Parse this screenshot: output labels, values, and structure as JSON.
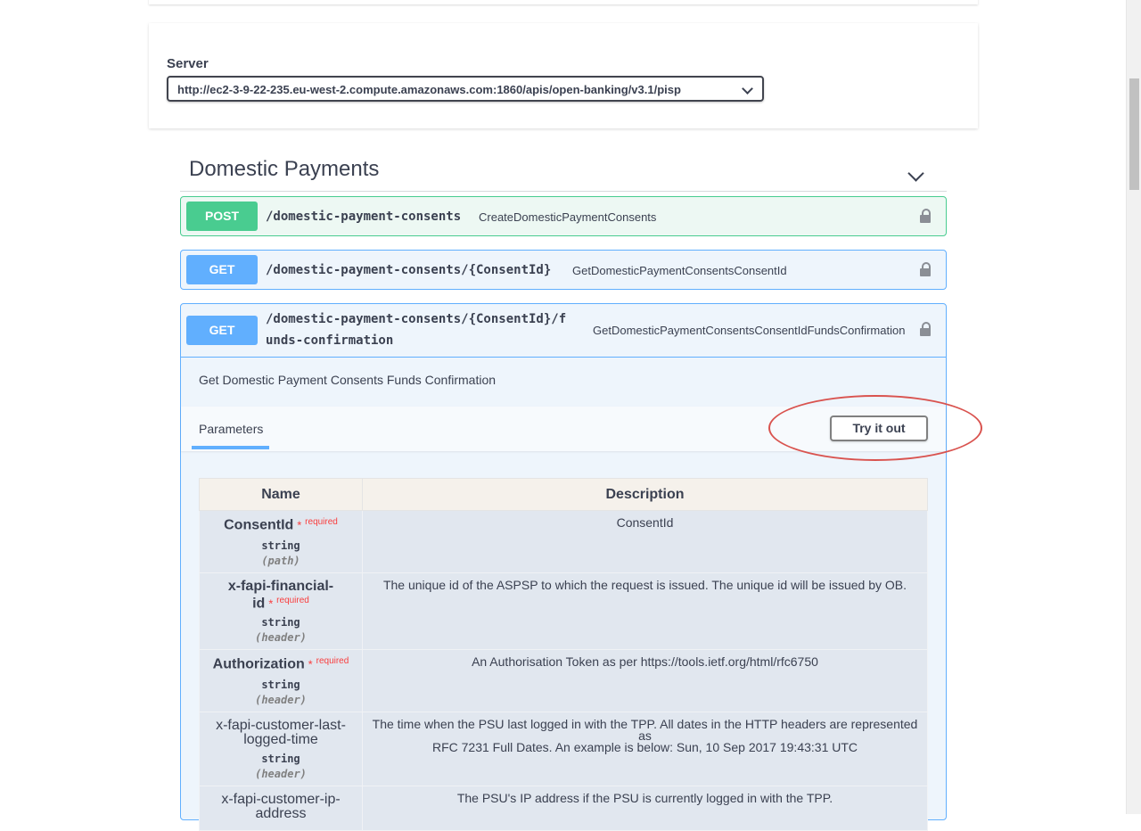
{
  "server": {
    "label": "Server",
    "selected": "http://ec2-3-9-22-235.eu-west-2.compute.amazonaws.com:1860/apis/open-banking/v3.1/pisp"
  },
  "tag": {
    "title": "Domestic Payments"
  },
  "operations": [
    {
      "method": "POST",
      "path": "/domestic-payment-consents",
      "summary": "CreateDomesticPaymentConsents"
    },
    {
      "method": "GET",
      "path": "/domestic-payment-consents/{ConsentId}",
      "summary": "GetDomesticPaymentConsentsConsentId"
    },
    {
      "method": "GET",
      "path_line1": "/domestic-payment-consents/{ConsentId}/f",
      "path_line2": "unds-confirmation",
      "summary": "GetDomesticPaymentConsentsConsentIdFundsConfirmation"
    }
  ],
  "expanded": {
    "description": "Get Domestic Payment Consents Funds Confirmation",
    "params_tab": "Parameters",
    "try_button": "Try it out",
    "table": {
      "headers": {
        "name": "Name",
        "description": "Description"
      },
      "rows": [
        {
          "name": "ConsentId",
          "required": "required",
          "type": "string",
          "in": "(path)",
          "description": "ConsentId"
        },
        {
          "name_line1": "x-fapi-financial-",
          "name_line2": "id",
          "required": "required",
          "type": "string",
          "in": "(header)",
          "description": "The unique id of the ASPSP to which the request is issued. The unique id will be issued by OB."
        },
        {
          "name": "Authorization",
          "required": "required",
          "type": "string",
          "in": "(header)",
          "description": "An Authorisation Token as per https://tools.ietf.org/html/rfc6750"
        },
        {
          "name_line1": "x-fapi-customer-last-",
          "name_line2": "logged-time",
          "type": "string",
          "in": "(header)",
          "description_line1": "The time when the PSU last logged in with the TPP. All dates in the HTTP headers are represented as",
          "description_line2": "RFC 7231 Full Dates. An example is below: Sun, 10 Sep 2017 19:43:31 UTC"
        },
        {
          "name_line1": "x-fapi-customer-ip-",
          "name_line2": "address",
          "description": "The PSU's IP address if the PSU is currently logged in with the TPP."
        }
      ]
    }
  },
  "required_star": "*",
  "colors": {
    "post": "#49cc90",
    "get": "#61affe",
    "highlight": "#d9534f"
  }
}
